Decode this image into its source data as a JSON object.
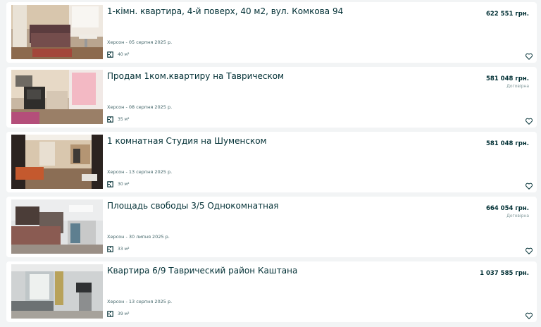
{
  "listings": [
    {
      "title": "1-кімн. квартира, 4-й поверх, 40 м2, вул. Комкова 94",
      "location_date": "Херсон - 05 серпня 2025 р.",
      "area": "40 м²",
      "price": "622 551 грн.",
      "negotiable": ""
    },
    {
      "title": "Продам 1ком.квартиру на Таврическом",
      "location_date": "Херсон - 08 серпня 2025 р.",
      "area": "35 м²",
      "price": "581 048 грн.",
      "negotiable": "Договірна"
    },
    {
      "title": "1 комнатная Студия на Шуменском",
      "location_date": "Херсон - 13 серпня 2025 р.",
      "area": "30 м²",
      "price": "581 048 грн.",
      "negotiable": ""
    },
    {
      "title": "Площадь свободы 3/5 Однокомнатная",
      "location_date": "Херсон - 30 липня 2025 р.",
      "area": "33 м²",
      "price": "664 054 грн.",
      "negotiable": "Договірна"
    },
    {
      "title": "Квартира 6/9 Таврический район Каштана",
      "location_date": "Херсон - 13 серпня 2025 р.",
      "area": "39 м²",
      "price": "1 037 585 грн.",
      "negotiable": ""
    }
  ],
  "icons": {
    "area": "floor-plan-icon",
    "favorite": "heart-icon"
  },
  "colors": {
    "text_primary": "#002f34",
    "text_secondary": "#406367",
    "page_background": "#f2f4f5",
    "card_background": "#ffffff"
  }
}
